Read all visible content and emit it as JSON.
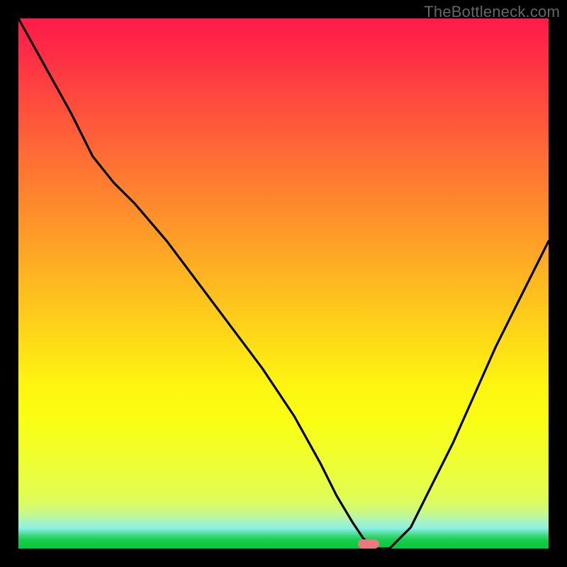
{
  "watermark": "TheBottleneck.com",
  "chart_data": {
    "type": "line",
    "title": "",
    "xlabel": "",
    "ylabel": "",
    "xlim": [
      0,
      100
    ],
    "ylim": [
      0,
      100
    ],
    "x": [
      0,
      5,
      10,
      14,
      18,
      22,
      28,
      34,
      40,
      46,
      52,
      57,
      60,
      63,
      65,
      67,
      70,
      74,
      78,
      82,
      86,
      90,
      94,
      100
    ],
    "values": [
      100,
      91,
      82,
      74,
      69,
      65,
      58,
      50,
      42,
      34,
      25,
      16,
      10,
      5,
      2,
      0,
      0,
      4,
      12,
      20,
      29,
      38,
      46,
      58
    ],
    "min_marker_x": 66,
    "gradient_stops": [
      {
        "pos": 0,
        "color": "#fe1b49"
      },
      {
        "pos": 0.25,
        "color": "#fe7034"
      },
      {
        "pos": 0.5,
        "color": "#feb322"
      },
      {
        "pos": 0.69,
        "color": "#fef510"
      },
      {
        "pos": 0.85,
        "color": "#e9fe3c"
      },
      {
        "pos": 0.95,
        "color": "#a5f4c6"
      },
      {
        "pos": 1.0,
        "color": "#05c837"
      }
    ],
    "min_marker_color": "#ee7880"
  }
}
